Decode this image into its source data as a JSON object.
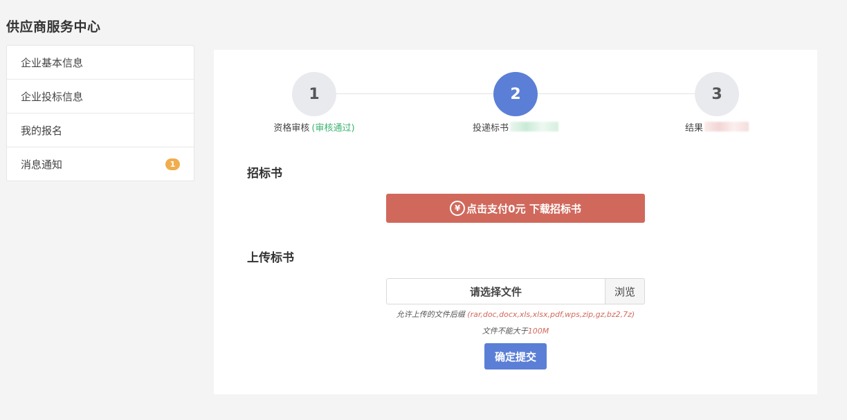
{
  "app": {
    "title": "供应商服务中心"
  },
  "sidebar": {
    "items": [
      {
        "label": "企业基本信息"
      },
      {
        "label": "企业投标信息"
      },
      {
        "label": "我的报名"
      },
      {
        "label": "消息通知",
        "badge": "1"
      }
    ]
  },
  "steps": [
    {
      "number": "1",
      "label": "资格审核",
      "status": "(审核通过)"
    },
    {
      "number": "2",
      "label": "投递标书"
    },
    {
      "number": "3",
      "label": "结果"
    }
  ],
  "tender": {
    "section_title": "招标书",
    "download_label": "点击支付0元 下载招标书",
    "download_icon": "yen-icon"
  },
  "upload": {
    "section_title": "上传标书",
    "file_placeholder": "请选择文件",
    "browse_label": "浏览",
    "allowed_prefix": "允许上传的文件后缀",
    "allowed_types": "(rar,doc,docx,xls,xlsx,pdf,wps,zip,gz,bz2,7z)",
    "size_prefix": "文件不能大于",
    "size_limit": "100M",
    "submit_label": "确定提交"
  },
  "colors": {
    "primary": "#5b7fd6",
    "danger": "#d0695c",
    "success": "#3cb371",
    "badge": "#f0ad4e"
  }
}
